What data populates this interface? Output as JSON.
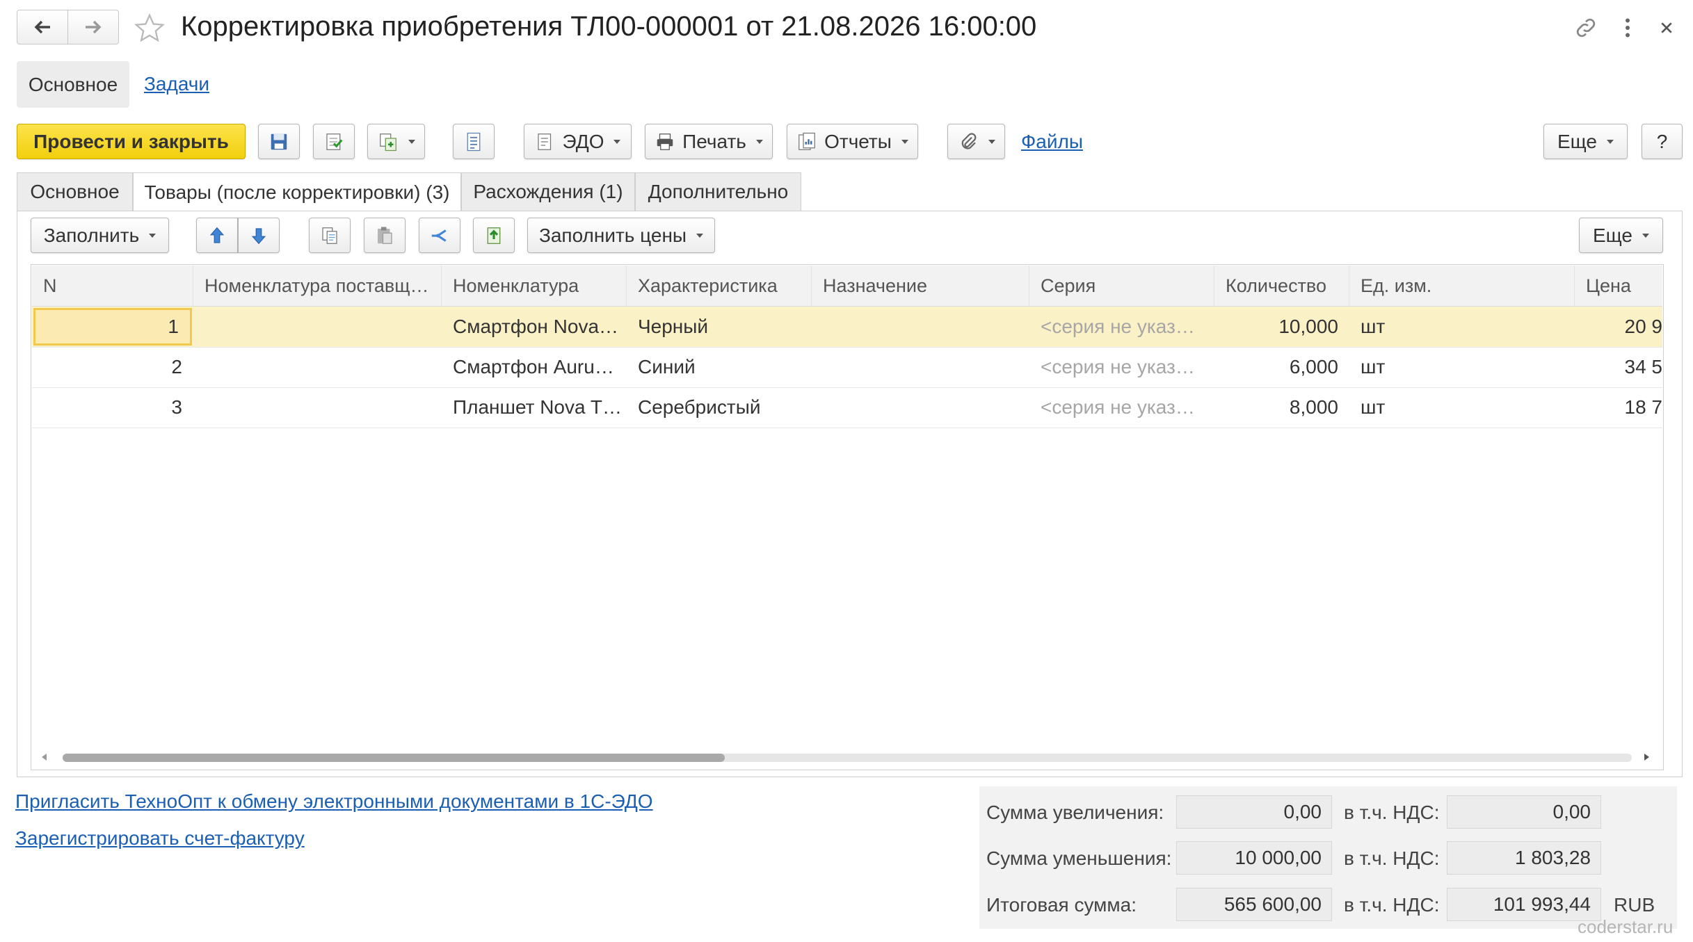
{
  "window": {
    "title": "Корректировка приобретения ТЛ00-000001 от 21.08.2026 16:00:00"
  },
  "top_nav": {
    "main_label": "Основное",
    "tasks_label": "Задачи"
  },
  "toolbar": {
    "post_close_label": "Провести и закрыть",
    "edo_label": "ЭДО",
    "print_label": "Печать",
    "reports_label": "Отчеты",
    "files_label": "Файлы",
    "more_label": "Еще",
    "help_label": "?"
  },
  "tabs": [
    {
      "label": "Основное"
    },
    {
      "label": "Товары (после корректировки) (3)"
    },
    {
      "label": "Расхождения (1)"
    },
    {
      "label": "Дополнительно"
    }
  ],
  "subtoolbar": {
    "fill_label": "Заполнить",
    "fill_prices_label": "Заполнить цены",
    "more_label": "Еще"
  },
  "table": {
    "columns": [
      "N",
      "Номенклатура поставщ…",
      "Номенклатура",
      "Характеристика",
      "Назначение",
      "Серия",
      "Количество",
      "Ед. изм.",
      "Цена"
    ],
    "rows": [
      {
        "n": "1",
        "supplier_item": "",
        "item": "Смартфон Nova…",
        "characteristic": "Черный",
        "purpose": "",
        "series": "<серия не указ…",
        "qty": "10,000",
        "unit": "шт",
        "price": "20 9"
      },
      {
        "n": "2",
        "supplier_item": "",
        "item": "Смартфон Auru…",
        "characteristic": "Синий",
        "purpose": "",
        "series": "<серия не указ…",
        "qty": "6,000",
        "unit": "шт",
        "price": "34 5"
      },
      {
        "n": "3",
        "supplier_item": "",
        "item": "Планшет Nova T…",
        "characteristic": "Серебристый",
        "purpose": "",
        "series": "<серия не указ…",
        "qty": "8,000",
        "unit": "шт",
        "price": "18 7"
      }
    ]
  },
  "links": {
    "invite_edo": "Пригласить ТехноОпт к обмену электронными документами в 1С-ЭДО",
    "register_invoice": "Зарегистрировать счет-фактуру"
  },
  "totals": {
    "increase_label": "Сумма увеличения:",
    "increase_value": "0,00",
    "decrease_label": "Сумма уменьшения:",
    "decrease_value": "10 000,00",
    "total_label": "Итоговая сумма:",
    "total_value": "565 600,00",
    "vat_label": "в т.ч. НДС:",
    "increase_vat": "0,00",
    "decrease_vat": "1 803,28",
    "total_vat": "101 993,44",
    "currency": "RUB"
  },
  "watermark": "coderstar.ru",
  "colors": {
    "accent_button": "#f5d40f",
    "selected_row": "#fbf1c7",
    "link": "#1a5fb4"
  }
}
